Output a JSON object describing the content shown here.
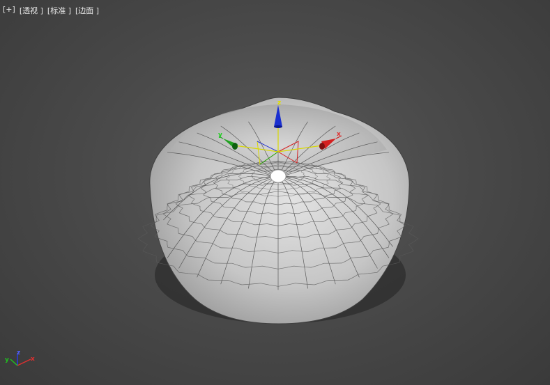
{
  "viewport": {
    "menu_plus": "[+]",
    "view_mode": "[透视 ]",
    "shading_mode": "[标准 ]",
    "display_mode": "[边面 ]"
  },
  "gizmo": {
    "x_label": "x",
    "y_label": "y",
    "z_label": "z"
  },
  "view_axis": {
    "x_label": "x",
    "y_label": "y",
    "z_label": "z"
  },
  "colors": {
    "x_axis": "#d42020",
    "y_axis": "#20a020",
    "z_axis": "#1a2fd0",
    "mesh_fill": "#c8c8c8",
    "wire": "#555555"
  }
}
